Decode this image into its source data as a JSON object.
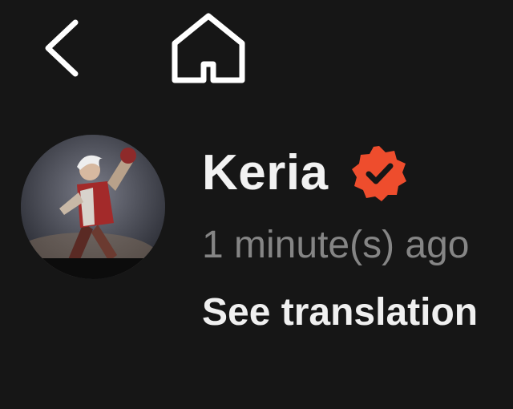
{
  "nav": {
    "back_icon": "chevron-left-icon",
    "home_icon": "home-icon"
  },
  "post": {
    "author_name": "Keria",
    "verified_icon": "verified-badge-icon",
    "verified_color": "#ee4d2d",
    "timestamp": "1 minute(s) ago",
    "translation_link": "See translation"
  },
  "colors": {
    "background": "#161616",
    "primary_text": "#f2f2f2",
    "secondary_text": "#858585"
  }
}
